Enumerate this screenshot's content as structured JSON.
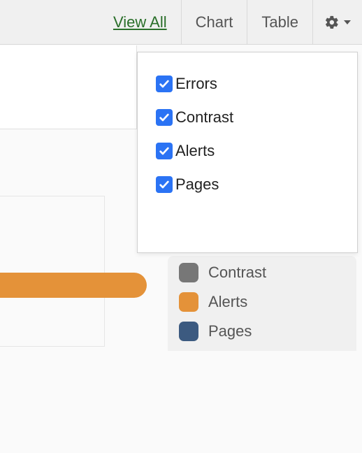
{
  "toolbar": {
    "view_all_label": "View All",
    "chart_label": "Chart",
    "table_label": "Table"
  },
  "dropdown": {
    "items": [
      {
        "label": "Errors",
        "checked": true
      },
      {
        "label": "Contrast",
        "checked": true
      },
      {
        "label": "Alerts",
        "checked": true
      },
      {
        "label": "Pages",
        "checked": true
      }
    ]
  },
  "legend": {
    "items": [
      {
        "label": "Contrast",
        "color": "#777777"
      },
      {
        "label": "Alerts",
        "color": "#e49239"
      },
      {
        "label": "Pages",
        "color": "#3c5a80"
      }
    ]
  }
}
